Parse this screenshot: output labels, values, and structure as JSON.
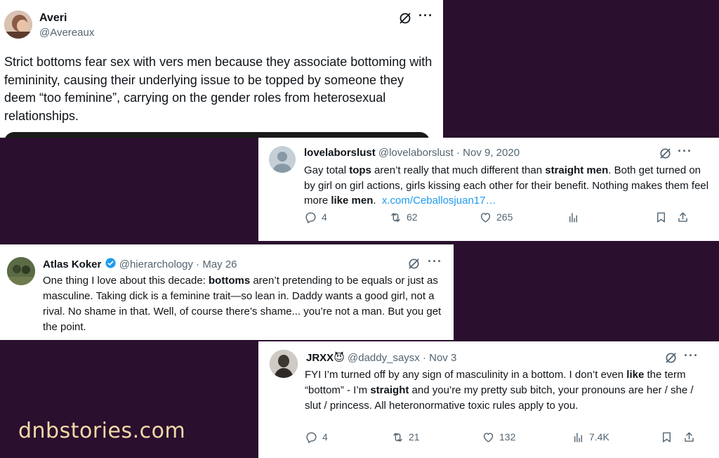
{
  "tweet1": {
    "name": "Averi",
    "handle": "@Avereaux",
    "text": "Strict bottoms fear sex with vers men because they associate bottoming with femininity, causing their underlying issue to be topped by someone they deem “too feminine”, carrying on the gender roles from heterosexual relationships."
  },
  "tweet2": {
    "name": "lovelaborslust",
    "handle": "@lovelaborslust",
    "date": "· Nov 9, 2020",
    "text_parts": [
      "Gay total ",
      "tops",
      " aren’t really that much different than ",
      "straight men",
      ". Both get turned on by girl on girl actions, girls kissing each other for their benefit. Nothing makes them feel more ",
      "like men",
      ".  "
    ],
    "link": "x.com/Ceballosjuan17…",
    "replies": "4",
    "reposts": "62",
    "likes": "265"
  },
  "tweet3": {
    "name": "Atlas Koker",
    "handle": "@hierarchology",
    "date": "· May 26",
    "text_parts": [
      "One thing I love about this decade: ",
      "bottoms",
      " aren’t pretending to be equals or just as masculine. Taking dick is a feminine trait—so lean in. Daddy wants a good girl, not a rival. No shame in that. Well, of course there’s shame... you’re not a man. But you get the point."
    ]
  },
  "tweet4": {
    "name": "JRXX",
    "emoji": "😈",
    "handle": "@daddy_saysx",
    "date": "· Nov 3",
    "text_parts": [
      "FYI I’m turned off by any sign of masculinity in a bottom. I don’t even ",
      "like",
      " the term “bottom” - I’m ",
      "straight",
      " and you’re my pretty sub bitch, your pronouns are her / she / slut / princess. All heteronormative toxic rules apply to you."
    ],
    "replies": "4",
    "reposts": "21",
    "likes": "132",
    "views": "7.4K"
  },
  "icons": {
    "more": "···",
    "grok": "grok-icon",
    "reply": "reply-icon",
    "repost": "repost-icon",
    "like": "like-icon",
    "views": "views-icon",
    "bookmark": "bookmark-icon",
    "share": "share-icon"
  },
  "colors": {
    "background": "#2a0f2e",
    "watermark": "#f0d9a8",
    "link": "#1d9bf0",
    "verified": "#1d9bf0"
  },
  "watermark": "dnbstories.com"
}
